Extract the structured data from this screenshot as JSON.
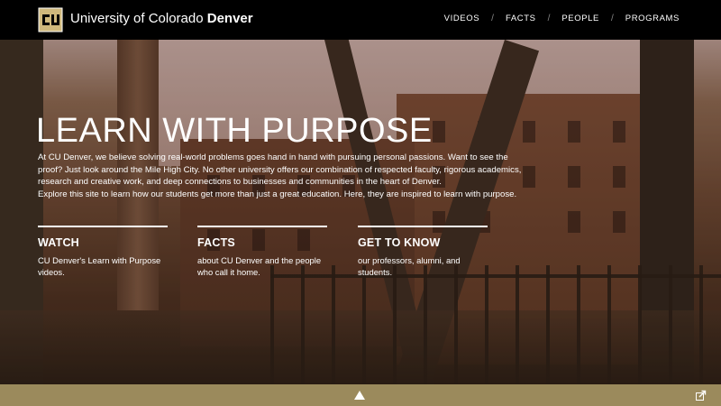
{
  "header": {
    "brand_prefix": "University of Colorado ",
    "brand_bold": "Denver",
    "nav": [
      {
        "label": "VIDEOS"
      },
      {
        "label": "FACTS"
      },
      {
        "label": "PEOPLE"
      },
      {
        "label": "PROGRAMS"
      }
    ],
    "nav_separator": "/"
  },
  "hero": {
    "title": "LEARN WITH PURPOSE",
    "paragraph1": "At CU Denver, we believe solving real-world problems goes hand in hand with pursuing personal passions. Want to see the proof? Just look around the Mile High City. No other university offers our combination of respected faculty, rigorous academics, research and creative work, and deep connections to businesses and communities in the heart of Denver.",
    "paragraph2": "Explore this site to learn how our students get more than just a great education. Here, they are inspired to learn with purpose."
  },
  "cards": [
    {
      "title": "WATCH",
      "text": "CU Denver's Learn with Purpose videos."
    },
    {
      "title": "FACTS",
      "text": "about CU Denver and the people who call it home."
    },
    {
      "title": "GET TO KNOW",
      "text": "our professors, alumni, and students."
    }
  ],
  "icons": {
    "logo": "cu-logo-icon",
    "scroll_up": "up-arrow-icon",
    "share": "share-icon"
  },
  "colors": {
    "header_bg": "#000000",
    "bottom_bar": "#9b8a5c",
    "logo_gold": "#cfb87c"
  }
}
